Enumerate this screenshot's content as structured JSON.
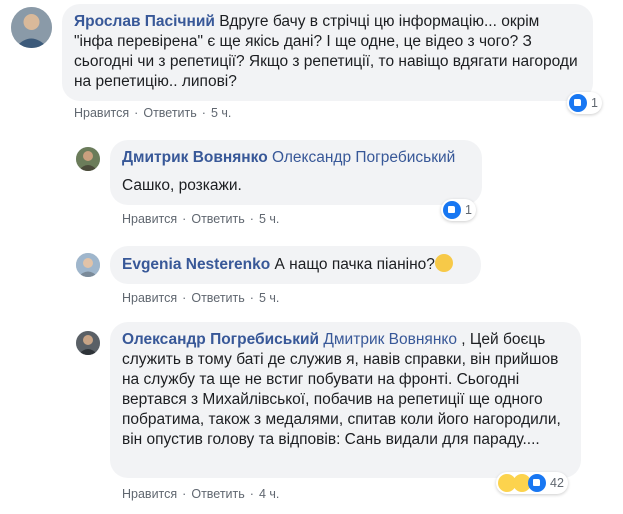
{
  "comments": [
    {
      "author": "Ярослав Пасічний",
      "mention": "",
      "text": "Вдруге бачу в стрічці цю інформацію... окрім \"інфа перевірена\" є ще якісь дані? І ще одне, це відео з чого? З сьогодні чи з репетиції? Якщо з репетиції, то навіщо вдягати нагороди на репетицію.. липові?",
      "actions": {
        "like": "Нравится",
        "reply": "Ответить",
        "time": "5 ч."
      },
      "reactions": {
        "count": "1",
        "icons": [
          "like-icon"
        ]
      }
    },
    {
      "author": "Дмитрик Вовнянко",
      "mention": "Олександр Погребиський",
      "text": "Сашко, розкажи.",
      "actions": {
        "like": "Нравится",
        "reply": "Ответить",
        "time": "5 ч."
      },
      "reactions": {
        "count": "1",
        "icons": [
          "like-icon"
        ]
      }
    },
    {
      "author": "Evgenia Nesterenko",
      "mention": "",
      "text": "А нащо пачка піаніно?",
      "emoji": "😛",
      "actions": {
        "like": "Нравится",
        "reply": "Ответить",
        "time": "5 ч."
      },
      "reactions": null
    },
    {
      "author": "Олександр Погребиський",
      "mention": "Дмитрик Вовнянко",
      "text": ", Цей боєць служить в тому баті де служив я, навів справки, він прийшов на службу та ще не встиг побувати на фронті. Сьогодні вертався з Михайлівської, побачив на репетиції ще одного побратима, також з медалями, спитав коли його нагородили, він опустив голову та відповів: Сань видали для параду....",
      "actions": {
        "like": "Нравится",
        "reply": "Ответить",
        "time": "4 ч."
      },
      "reactions": {
        "count": "42",
        "icons": [
          "wow-icon",
          "sad-icon",
          "like-icon"
        ]
      }
    }
  ],
  "colors": {
    "link": "#385898",
    "bubble": "#f2f3f5",
    "meta": "#606770",
    "like": "#1877f2"
  }
}
